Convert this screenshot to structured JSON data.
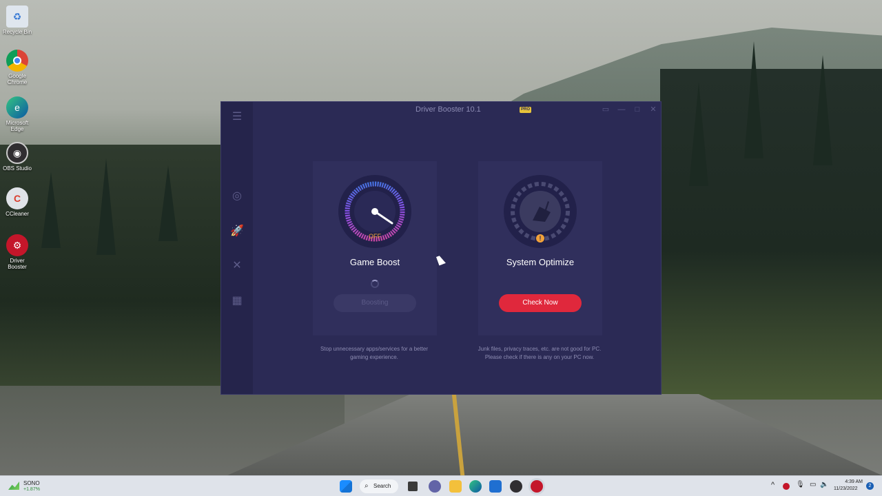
{
  "desktop": {
    "icons": [
      {
        "label": "Recycle Bin",
        "icon": "recycle-bin-icon"
      },
      {
        "label": "Google Chrome",
        "icon": "chrome-icon"
      },
      {
        "label": "Microsoft Edge",
        "icon": "edge-icon"
      },
      {
        "label": "OBS Studio",
        "icon": "obs-icon"
      },
      {
        "label": "CCleaner",
        "icon": "ccleaner-icon"
      },
      {
        "label": "Driver Booster",
        "icon": "driver-booster-icon"
      }
    ]
  },
  "app": {
    "title": "Driver Booster 10.1",
    "badge": "PRO",
    "accent": "#e0283c",
    "game_boost": {
      "status": "OFF",
      "title": "Game Boost",
      "button": "Boosting",
      "description": "Stop unnecessary apps/services for a better gaming experience."
    },
    "system_optimize": {
      "title": "System Optimize",
      "button": "Check Now",
      "description": "Junk files, privacy traces, etc. are not good for PC. Please check if there is any on your PC now."
    }
  },
  "taskbar": {
    "stock_name": "SONO",
    "stock_change": "+1.87%",
    "search_label": "Search",
    "time": "4:39 AM",
    "date": "11/23/2022",
    "notification_count": "2"
  }
}
